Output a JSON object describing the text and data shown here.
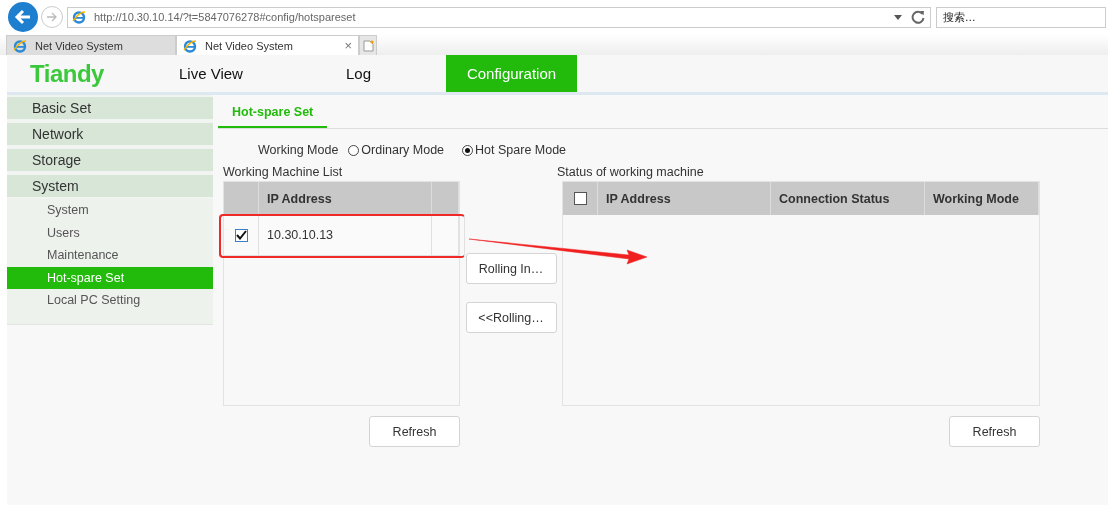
{
  "browser": {
    "address": "http://10.30.10.14/?t=5847076278#config/hotspareset",
    "search_placeholder": "搜索...",
    "tabs": [
      {
        "title": "Net Video System",
        "selected": false
      },
      {
        "title": "Net Video System",
        "selected": true,
        "close": "×"
      }
    ]
  },
  "header": {
    "logo": "Tiandy",
    "nav": [
      {
        "label": "Live View",
        "selected": false
      },
      {
        "label": "Log",
        "selected": false
      },
      {
        "label": "Configuration",
        "selected": true
      }
    ]
  },
  "sidebar": {
    "items": [
      {
        "label": "Basic Set"
      },
      {
        "label": "Network"
      },
      {
        "label": "Storage"
      },
      {
        "label": "System",
        "children": [
          {
            "label": "System",
            "selected": false
          },
          {
            "label": "Users",
            "selected": false
          },
          {
            "label": "Maintenance",
            "selected": false
          },
          {
            "label": "Hot-spare Set",
            "selected": true
          },
          {
            "label": "Local PC Setting",
            "selected": false
          }
        ]
      }
    ]
  },
  "content": {
    "tabs": [
      {
        "label": "Hot-spare Set",
        "selected": true
      }
    ],
    "working_mode": {
      "label": "Working Mode",
      "options": [
        {
          "label": "Ordinary Mode",
          "selected": false
        },
        {
          "label": "Hot Spare Mode",
          "selected": true
        }
      ]
    },
    "working_list": {
      "title": "Working Machine List",
      "columns": [
        "IP Address"
      ],
      "rows": [
        {
          "ip": "10.30.10.13",
          "checked": true,
          "highlighted": true
        }
      ],
      "refresh": "Refresh"
    },
    "move_buttons": [
      "Rolling In…",
      "<<Rolling…"
    ],
    "status_list": {
      "title": "Status of working machine",
      "all_checked": false,
      "columns": [
        "IP Address",
        "Connection Status",
        "Working Mode"
      ],
      "refresh": "Refresh"
    },
    "annotation_arrow": true
  }
}
